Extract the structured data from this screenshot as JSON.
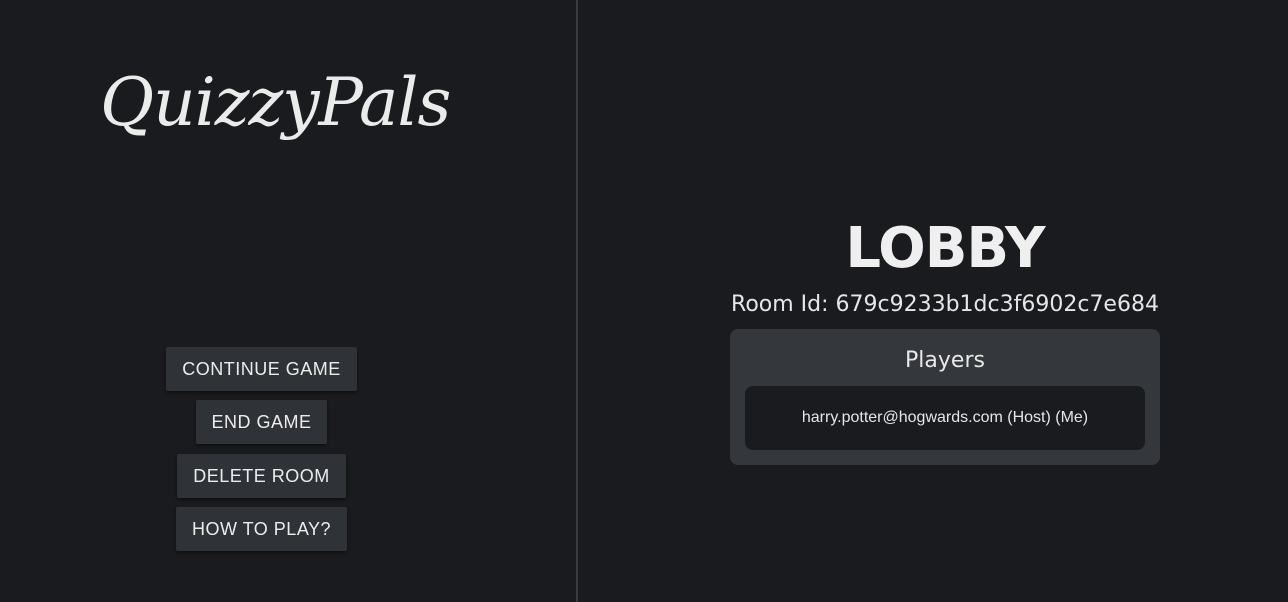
{
  "app": {
    "logo_text": "QuizzyPals"
  },
  "menu": {
    "continue_label": "CONTINUE GAME",
    "end_label": "END GAME",
    "delete_label": "DELETE ROOM",
    "howto_label": "HOW TO PLAY?"
  },
  "lobby": {
    "title": "LOBBY",
    "room_id_text": "Room Id: 679c9233b1dc3f6902c7e684",
    "players_heading": "Players",
    "players": [
      {
        "label": "harry.potter@hogwards.com (Host) (Me)"
      }
    ]
  },
  "colors": {
    "background": "#1a1b1e",
    "button_bg": "#2f3236",
    "card_bg": "#34373b",
    "divider": "#3a3b3e",
    "text": "#e8e8e8"
  }
}
